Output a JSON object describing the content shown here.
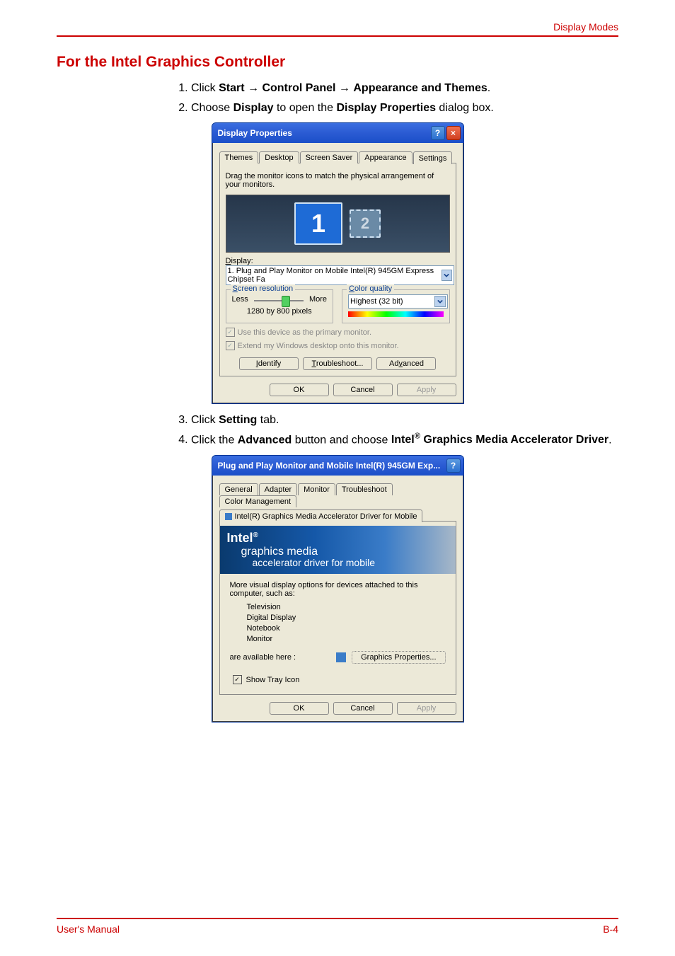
{
  "header": {
    "right": "Display Modes"
  },
  "section_title": "For the Intel Graphics Controller",
  "steps": {
    "s1_pre": "Click ",
    "s1_b1": "Start",
    "s1_arr": " → ",
    "s1_b2": "Control Panel",
    "s1_b3": "Appearance and Themes",
    "s1_end": ".",
    "s2_pre": "Choose ",
    "s2_b1": "Display",
    "s2_mid": " to open the ",
    "s2_b2": "Display Properties",
    "s2_end": " dialog box.",
    "s3_pre": "Click ",
    "s3_b1": "Setting",
    "s3_end": " tab.",
    "s4_pre": "Click the ",
    "s4_b1": "Advanced",
    "s4_mid": " button and choose ",
    "s4_b2a": "Intel",
    "s4_b2b": " Graphics Media Accelerator Driver",
    "s4_sup": "®",
    "s4_end": "."
  },
  "dialog1": {
    "title": "Display Properties",
    "tabs": {
      "t1": "Themes",
      "t2": "Desktop",
      "t3": "Screen Saver",
      "t4": "Appearance",
      "t5": "Settings"
    },
    "instruction": "Drag the monitor icons to match the physical arrangement of your monitors.",
    "mon1": "1",
    "mon2": "2",
    "display_label": "Display:",
    "display_sel": "1. Plug and Play Monitor on Mobile Intel(R) 945GM Express Chipset Fa",
    "group_res": "Screen resolution",
    "less": "Less",
    "more": "More",
    "resolution": "1280 by 800 pixels",
    "group_color": "Color quality",
    "color_sel": "Highest (32 bit)",
    "chk_primary": "Use this device as the primary monitor.",
    "chk_extend": "Extend my Windows desktop onto this monitor.",
    "btn_identify": "Identify",
    "btn_trouble": "Troubleshoot...",
    "btn_advanced": "Advanced",
    "btn_ok": "OK",
    "btn_cancel": "Cancel",
    "btn_apply": "Apply"
  },
  "dialog2": {
    "title": "Plug and Play Monitor and Mobile Intel(R) 945GM Exp...",
    "tabs": {
      "t1": "General",
      "t2": "Adapter",
      "t3": "Monitor",
      "t4": "Troubleshoot",
      "t5": "Color Management",
      "t6": "Intel(R) Graphics Media Accelerator Driver for Mobile"
    },
    "brand": "Intel",
    "brand_l2": "graphics media",
    "brand_l3": "accelerator driver for mobile",
    "body1": "More visual display options for devices attached to this computer, such as:",
    "li1": "Television",
    "li2": "Digital Display",
    "li3": "Notebook",
    "li4": "Monitor",
    "avail": "are available here :",
    "gp_btn": "Graphics Properties...",
    "show_tray": "Show Tray Icon",
    "btn_ok": "OK",
    "btn_cancel": "Cancel",
    "btn_apply": "Apply"
  },
  "footer": {
    "left": "User's Manual",
    "right": "B-4"
  }
}
